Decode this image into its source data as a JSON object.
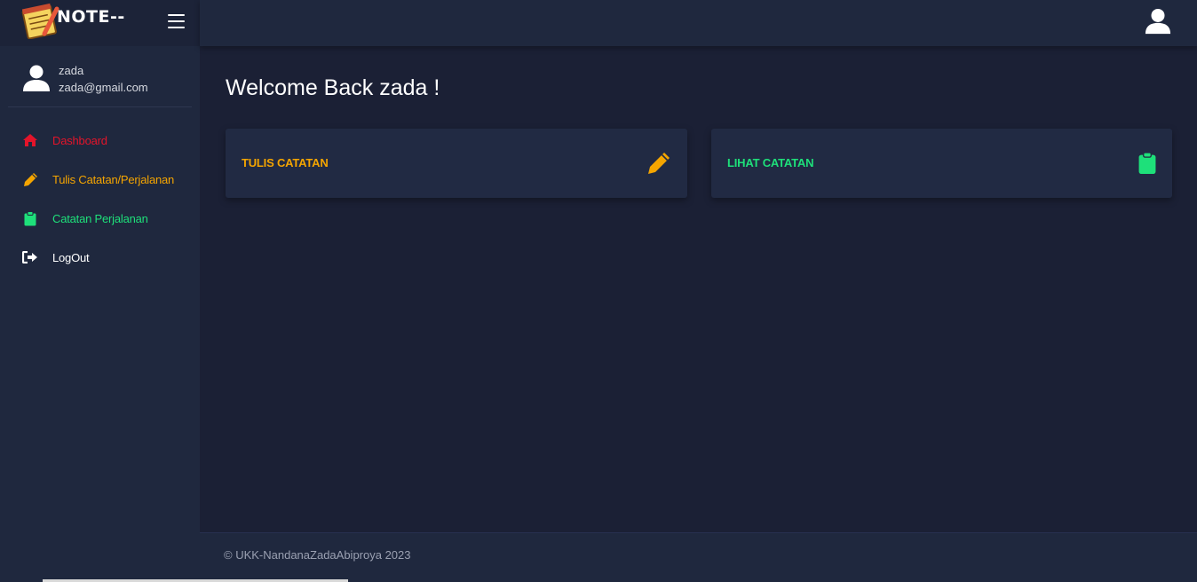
{
  "brand": {
    "name": "NOTE--"
  },
  "user": {
    "name": "zada",
    "email": "zada@gmail.com"
  },
  "nav": {
    "items": [
      {
        "label": "Dashboard",
        "icon": "home-icon",
        "color": "#e3142a"
      },
      {
        "label": "Tulis Catatan/Perjalanan",
        "icon": "pencil-icon",
        "color": "#f5a500"
      },
      {
        "label": "Catatan Perjalanan",
        "icon": "clipboard-icon",
        "color": "#1ee07a"
      },
      {
        "label": "LogOut",
        "icon": "sign-out-icon",
        "color": "#ffffff"
      }
    ]
  },
  "main": {
    "welcome": "Welcome Back zada !",
    "cards": [
      {
        "title": "TULIS CATATAN",
        "icon": "pencil-icon",
        "color": "#f5a500"
      },
      {
        "title": "LIHAT CATATAN",
        "icon": "clipboard-icon",
        "color": "#1ee07a"
      }
    ]
  },
  "footer": {
    "text": "© UKK-NandanaZadaAbiproya 2023"
  },
  "colors": {
    "background": "#1b2035",
    "sidebar": "#1f283e",
    "card": "#212a43",
    "accent_red": "#e3142a",
    "accent_orange": "#f5a500",
    "accent_green": "#1ee07a"
  }
}
